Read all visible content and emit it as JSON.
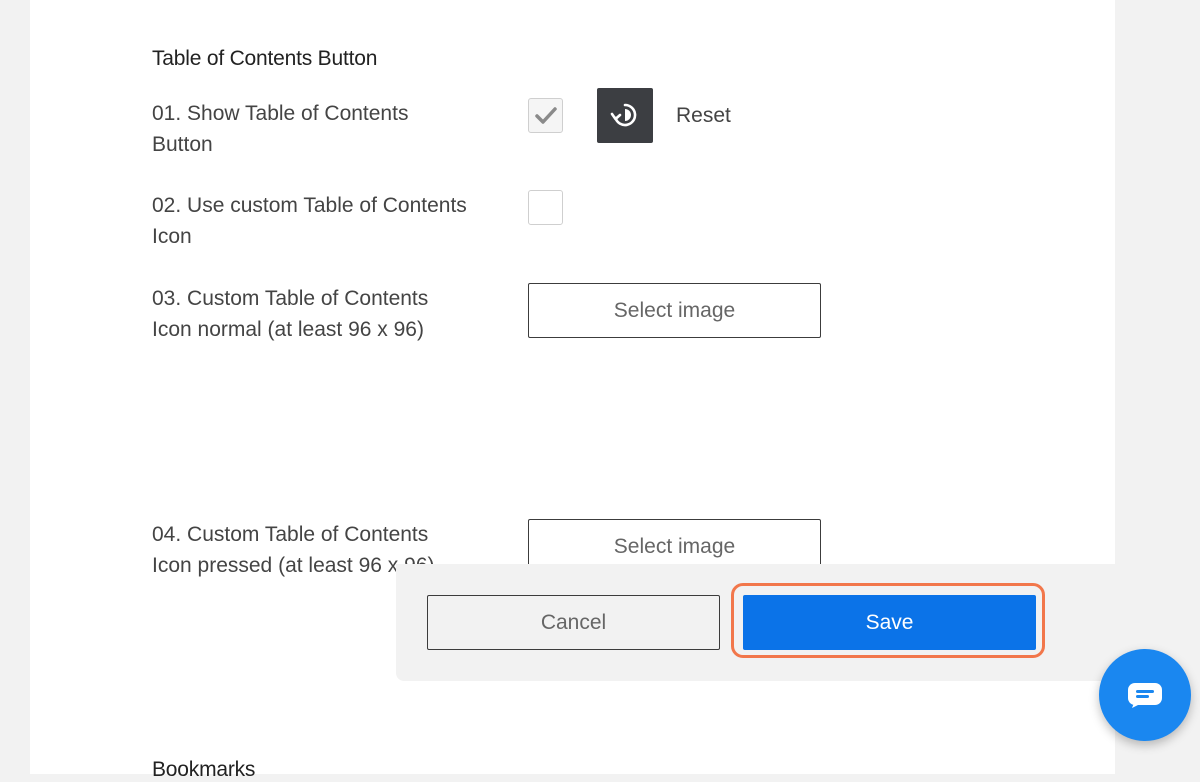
{
  "section": {
    "title": "Table of Contents Button",
    "next_title": "Bookmarks"
  },
  "options": [
    {
      "label": "01. Show Table of Contents Button",
      "checked": true
    },
    {
      "label": "02. Use custom Table of Contents Icon",
      "checked": false
    },
    {
      "label": "03. Custom Table of Contents Icon normal (at least 96 x 96)",
      "button": "Select image"
    },
    {
      "label": "04. Custom Table of Contents Icon pressed (at least 96 x 96)",
      "button": "Select image"
    }
  ],
  "reset": {
    "label": "Reset",
    "icon": "reset-icon"
  },
  "footer": {
    "cancel": "Cancel",
    "save": "Save"
  },
  "chat": {
    "icon": "chat-icon"
  },
  "colors": {
    "accent": "#0b73e8",
    "highlight": "#f2774b",
    "dark_button": "#3c3e42",
    "chat": "#1a87f0"
  }
}
